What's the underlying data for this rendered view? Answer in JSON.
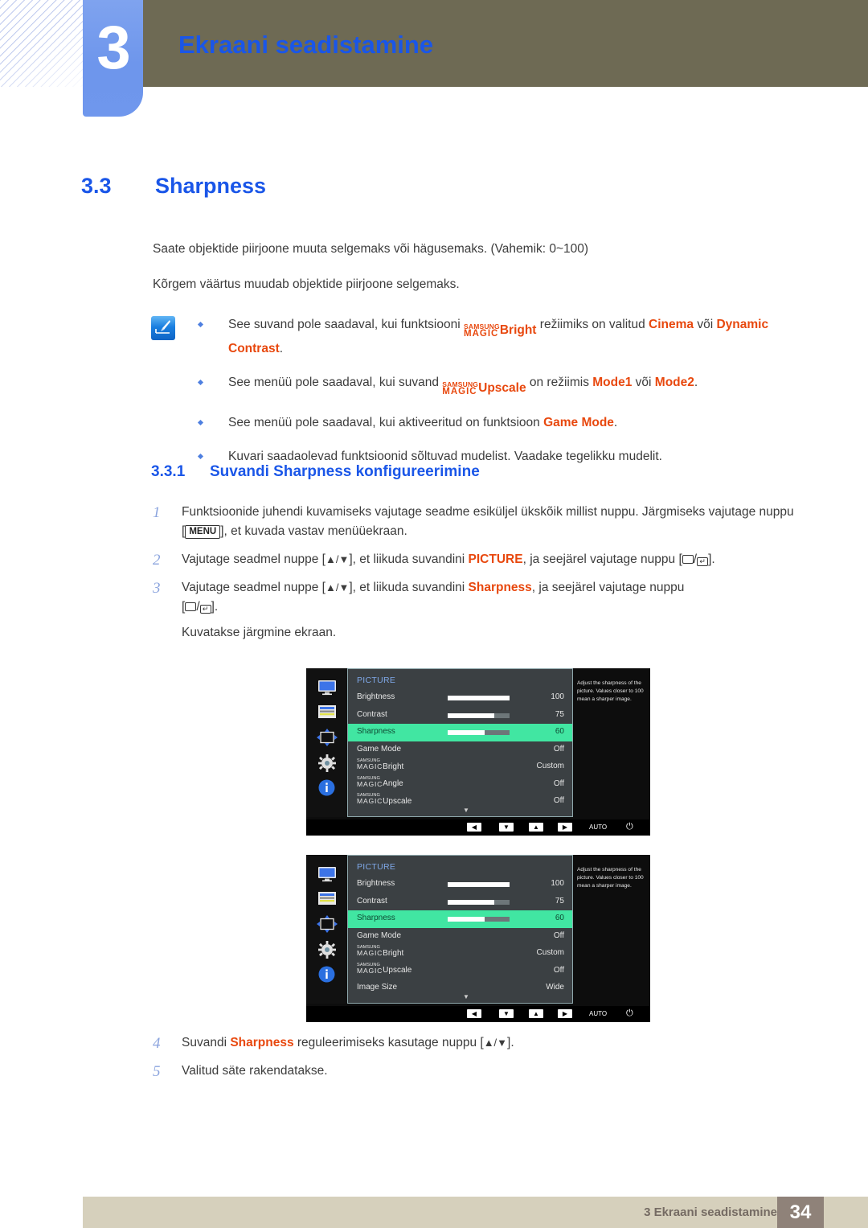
{
  "header": {
    "chapter_number": "3",
    "chapter_title": "Ekraani seadistamine"
  },
  "section": {
    "number": "3.3",
    "title": "Sharpness"
  },
  "body": {
    "paragraph1": "Saate objektide piirjoone muuta selgemaks või hägusemaks. (Vahemik: 0~100)",
    "paragraph2": "Kõrgem väärtus muudab objektide piirjoone selgemaks."
  },
  "notes": {
    "icon": "note-pencil-icon",
    "items": [
      {
        "pre": "See suvand pole saadaval, kui funktsiooni ",
        "magic_top": "SAMSUNG",
        "magic_bottom": "MAGIC",
        "magic_suffix": "Bright",
        "mid": " režiimiks on valitud ",
        "hl1": "Cinema",
        "mid2": " või ",
        "hl2": "Dynamic Contrast",
        "post": "."
      },
      {
        "pre": "See menüü pole saadaval, kui suvand ",
        "magic_top": "SAMSUNG",
        "magic_bottom": "MAGIC",
        "magic_suffix": "Upscale",
        "mid": " on režiimis ",
        "hl1": "Mode1",
        "mid2": " või ",
        "hl2": "Mode2",
        "post": "."
      },
      {
        "pre": "See menüü pole saadaval, kui aktiveeritud on funktsioon ",
        "hl1": "Game Mode",
        "post": "."
      },
      {
        "pre": "Kuvari saadaolevad funktsioonid sõltuvad mudelist. Vaadake tegelikku mudelit."
      }
    ]
  },
  "subsection": {
    "number": "3.3.1",
    "title": "Suvandi Sharpness konfigureerimine"
  },
  "steps": {
    "step1": {
      "num": "1",
      "text_a": "Funktsioonide juhendi kuvamiseks vajutage seadme esiküljel ükskõik millist nuppu. Järgmiseks vajutage nuppu [",
      "key": "MENU",
      "text_b": "], et kuvada vastav menüüekraan."
    },
    "step2": {
      "num": "2",
      "text_a": "Vajutage seadmel nuppe [",
      "arrows": "▲/▼",
      "text_b": "], et liikuda suvandini ",
      "hl": "PICTURE",
      "text_c": ", ja seejärel vajutage nuppu [",
      "text_d": "/",
      "text_e": "]."
    },
    "step3": {
      "num": "3",
      "text_a": "Vajutage seadmel nuppe [",
      "arrows": "▲/▼",
      "text_b": "], et liikuda suvandini ",
      "hl": "Sharpness",
      "text_c": ", ja seejärel vajutage nuppu",
      "text_d": "[",
      "text_e": "/",
      "text_f": "].",
      "sub": "Kuvatakse järgmine ekraan."
    },
    "step4": {
      "num": "4",
      "text_a": "Suvandi ",
      "hl": "Sharpness",
      "text_b": " reguleerimiseks kasutage nuppu [",
      "arrows": "▲/▼",
      "text_c": "]."
    },
    "step5": {
      "num": "5",
      "text_a": "Valitud säte rakendatakse."
    }
  },
  "osd": {
    "sidebar_icons": [
      "monitor-icon",
      "picture-list-icon",
      "move-arrows-icon",
      "gear-icon",
      "info-icon"
    ],
    "bottom_bar": {
      "buttons": [
        "◀",
        "▼",
        "▲",
        "▶"
      ],
      "auto_label": "AUTO",
      "power_label": "⏻"
    },
    "description": "Adjust the sharpness of the picture. Values closer to 100 mean a sharper image.",
    "screen1": {
      "title": "PICTURE",
      "rows": [
        {
          "label": "Brightness",
          "value": "100",
          "bar": 100,
          "selected": false
        },
        {
          "label": "Contrast",
          "value": "75",
          "bar": 75,
          "selected": false
        },
        {
          "label": "Sharpness",
          "value": "60",
          "bar": 60,
          "selected": true
        },
        {
          "label": "Game Mode",
          "value": "Off",
          "selected": false
        },
        {
          "magic_top": "SAMSUNG",
          "magic_bottom": "MAGIC",
          "magic_suffix": "Bright",
          "value": "Custom",
          "selected": false
        },
        {
          "magic_top": "SAMSUNG",
          "magic_bottom": "MAGIC",
          "magic_suffix": "Angle",
          "value": "Off",
          "selected": false
        },
        {
          "magic_top": "SAMSUNG",
          "magic_bottom": "MAGIC",
          "magic_suffix": "Upscale",
          "value": "Off",
          "selected": false
        }
      ],
      "scroll_caret": "▼"
    },
    "screen2": {
      "title": "PICTURE",
      "rows": [
        {
          "label": "Brightness",
          "value": "100",
          "bar": 100,
          "selected": false
        },
        {
          "label": "Contrast",
          "value": "75",
          "bar": 75,
          "selected": false
        },
        {
          "label": "Sharpness",
          "value": "60",
          "bar": 60,
          "selected": true
        },
        {
          "label": "Game Mode",
          "value": "Off",
          "selected": false
        },
        {
          "magic_top": "SAMSUNG",
          "magic_bottom": "MAGIC",
          "magic_suffix": "Bright",
          "value": "Custom",
          "selected": false
        },
        {
          "magic_top": "SAMSUNG",
          "magic_bottom": "MAGIC",
          "magic_suffix": "Upscale",
          "value": "Off",
          "selected": false
        },
        {
          "label": "Image Size",
          "value": "Wide",
          "selected": false
        }
      ],
      "scroll_caret": "▼"
    }
  },
  "footer": {
    "text": "3 Ekraani seadistamine",
    "page": "34"
  },
  "colors": {
    "brand_blue": "#1a56e8",
    "highlight_orange": "#e8480e",
    "osd_selected_green": "#41e6a2",
    "header_band": "#6e6a54",
    "footer_band": "#d6d0bc",
    "page_badge": "#8f8279"
  }
}
